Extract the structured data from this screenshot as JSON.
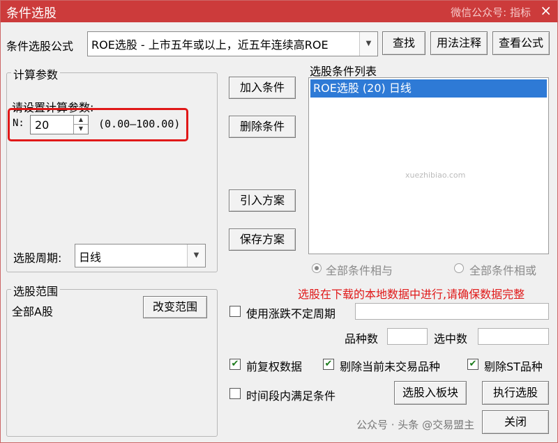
{
  "window": {
    "title": "条件选股",
    "close": "×",
    "watermark": "微信公众号: 指标"
  },
  "formula": {
    "label": "条件选股公式",
    "value": "ROE选股  -  上市五年或以上，近五年连续高ROE",
    "find": "查找",
    "usage": "用法注释",
    "view": "查看公式"
  },
  "params": {
    "group_title": "计算参数",
    "prompt": "请设置计算参数:",
    "n_label": "N:",
    "n_value": "20",
    "range": "(0.00—100.00)"
  },
  "actions": {
    "add": "加入条件",
    "delete": "删除条件",
    "import": "引入方案",
    "save": "保存方案"
  },
  "conditions": {
    "title": "选股条件列表",
    "items": [
      "ROE选股 (20) 日线"
    ],
    "and_label": "全部条件相与",
    "or_label": "全部条件相或"
  },
  "period": {
    "label": "选股周期:",
    "value": "日线"
  },
  "scope": {
    "group_title": "选股范围",
    "value": "全部A股",
    "change": "改变范围"
  },
  "notice": "选股在下载的本地数据中进行,请确保数据完整",
  "options": {
    "variable_period": {
      "label": "使用涨跌不定周期",
      "checked": false
    },
    "variety_count": "品种数",
    "selected_count": "选中数",
    "pre_adjust": {
      "label": "前复权数据",
      "checked": true
    },
    "exclude_suspended": {
      "label": "剔除当前未交易品种",
      "checked": true
    },
    "exclude_st": {
      "label": "剔除ST品种",
      "checked": true
    },
    "time_range": {
      "label": "时间段内满足条件",
      "checked": false
    }
  },
  "buttons": {
    "to_block": "选股入板块",
    "execute": "执行选股",
    "close": "关闭"
  },
  "footer": {
    "wm": "公众号 · 头条 @交易盟主",
    "site": "xuezhibiao.com"
  }
}
